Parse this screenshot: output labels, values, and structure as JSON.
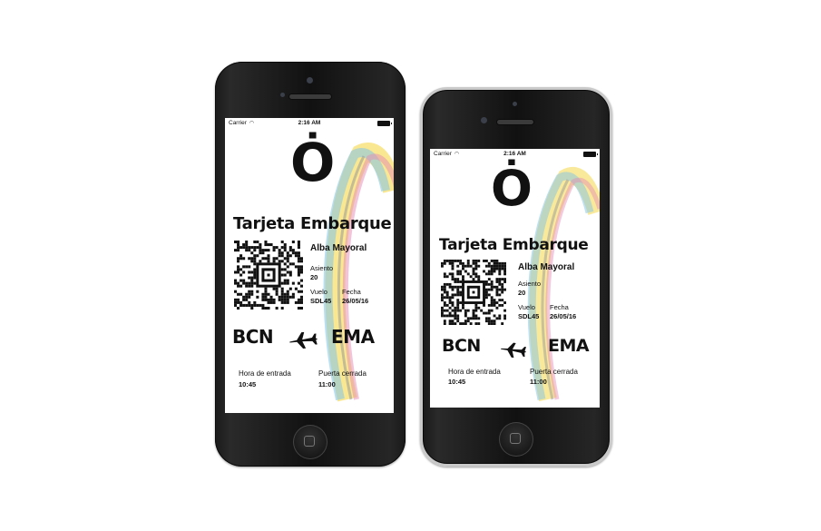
{
  "status_bar": {
    "carrier": "Carrier",
    "time": "2:16 AM"
  },
  "pass": {
    "logo": "Ȯ",
    "title": "Tarjeta Embarque",
    "passenger": "Alba Mayoral",
    "seat_label": "Asiento",
    "seat_value": "20",
    "flight_label": "Vuelo",
    "flight_value": "SDL45",
    "date_label": "Fecha",
    "date_value": "26/05/16",
    "origin": "BCN",
    "destination": "EMA",
    "boarding_label": "Hora de entrada",
    "boarding_value": "10:45",
    "gate_close_label": "Puerta cerrada",
    "gate_close_value": "11:00"
  },
  "icons": {
    "plane": "airplane-icon",
    "qr": "qr-code-icon",
    "wifi": "wifi-icon",
    "battery": "battery-icon"
  }
}
